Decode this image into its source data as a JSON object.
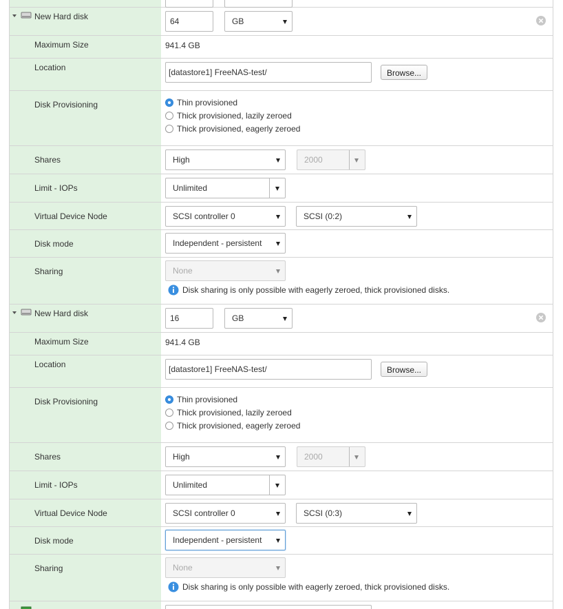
{
  "disks": [
    {
      "title": "New Hard disk",
      "size_value": "64",
      "size_unit": "GB",
      "labels": {
        "max_size": "Maximum Size",
        "location": "Location",
        "provisioning": "Disk Provisioning",
        "shares": "Shares",
        "limit": "Limit - IOPs",
        "vdn": "Virtual Device Node",
        "mode": "Disk mode",
        "sharing": "Sharing"
      },
      "max_size": "941.4 GB",
      "location": "[datastore1] FreeNAS-test/",
      "browse_label": "Browse...",
      "provisioning": [
        {
          "label": "Thin provisioned",
          "selected": true
        },
        {
          "label": "Thick provisioned, lazily zeroed",
          "selected": false
        },
        {
          "label": "Thick provisioned, eagerly zeroed",
          "selected": false
        }
      ],
      "shares": "High",
      "shares_value": "2000",
      "limit": "Unlimited",
      "controller": "SCSI controller 0",
      "node": "SCSI (0:2)",
      "mode": "Independent - persistent",
      "sharing": "None",
      "sharing_info": "Disk sharing is only possible with eagerly zeroed, thick provisioned disks."
    },
    {
      "title": "New Hard disk",
      "size_value": "16",
      "size_unit": "GB",
      "labels": {
        "max_size": "Maximum Size",
        "location": "Location",
        "provisioning": "Disk Provisioning",
        "shares": "Shares",
        "limit": "Limit - IOPs",
        "vdn": "Virtual Device Node",
        "mode": "Disk mode",
        "sharing": "Sharing"
      },
      "max_size": "941.4 GB",
      "location": "[datastore1] FreeNAS-test/",
      "browse_label": "Browse...",
      "provisioning": [
        {
          "label": "Thin provisioned",
          "selected": true
        },
        {
          "label": "Thick provisioned, lazily zeroed",
          "selected": false
        },
        {
          "label": "Thick provisioned, eagerly zeroed",
          "selected": false
        }
      ],
      "shares": "High",
      "shares_value": "2000",
      "limit": "Unlimited",
      "controller": "SCSI controller 0",
      "node": "SCSI (0:3)",
      "mode": "Independent - persistent",
      "sharing": "None",
      "sharing_info": "Disk sharing is only possible with eagerly zeroed, thick provisioned disks."
    }
  ],
  "colors": {
    "label_bg": "#e1f2e1",
    "radio_selected": "#3a8fe0",
    "info_icon": "#3a8fe0",
    "focus_border": "#5b9bd5"
  }
}
